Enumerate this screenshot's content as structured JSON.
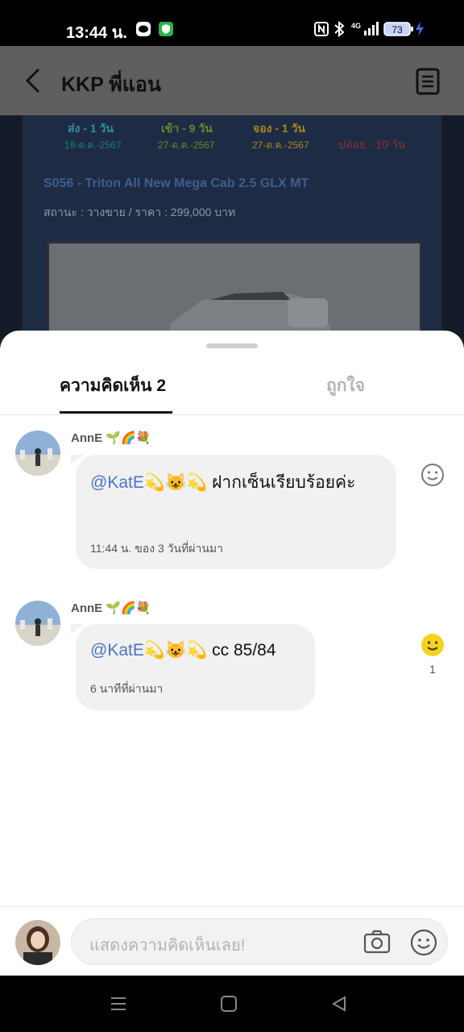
{
  "status_bar": {
    "time": "13:44 น.",
    "network": "4G",
    "battery": "73",
    "icons": [
      "line-icon",
      "shield-vpn-icon",
      "nfc-icon",
      "bluetooth-icon",
      "signal-icon",
      "battery-icon",
      "charging-icon"
    ]
  },
  "header": {
    "title": "KKP พี่แอน",
    "back_icon": "back-arrow-icon",
    "menu_icon": "document-list-icon"
  },
  "background_post": {
    "stats": [
      {
        "label": "ส่ง - 1 วัน",
        "date": "19-ต.ค.-2567",
        "color": "#2f8fa6"
      },
      {
        "label": "เข้า - 9 วัน",
        "date": "27-ต.ค.-2567",
        "color": "#5e8f2f"
      },
      {
        "label": "จอง - 1 วัน",
        "date": "27-ต.ค.-2567",
        "color": "#a9851e"
      },
      {
        "label": "",
        "date": "ปล่อย - 10 วัน",
        "color": "#8c3232"
      }
    ],
    "car_title": "S056 - Triton All New Mega Cab 2.5 GLX MT",
    "car_status": "สถานะ : วางขาย / ราคา : 299,000 บาท"
  },
  "tabs": {
    "comments": "ความคิดเห็น 2",
    "likes": "ถูกใจ"
  },
  "comments": [
    {
      "author": "AnnE 🌱🌈💐",
      "mention": "@KatE💫😺💫",
      "text": " ฝากเซ็นเรียบร้อยค่ะ",
      "time": "11:44 น. ของ 3 วันที่ผ่านมา",
      "reaction_count": ""
    },
    {
      "author": "AnnE 🌱🌈💐",
      "mention": "@KatE💫😺💫",
      "text": " cc 85/84",
      "time": "6 นาทีที่ผ่านมา",
      "reaction_count": "1"
    }
  ],
  "composer": {
    "placeholder": "แสดงความคิดเห็นเลย!",
    "camera_icon": "camera-icon",
    "emoji_icon": "emoji-icon"
  },
  "nav_bar": {
    "icons": [
      "recent-apps-icon",
      "home-icon",
      "back-icon"
    ]
  },
  "colors": {
    "mention": "#4a74c9",
    "reaction_active": "#f7d21b",
    "bubble": "#f1f1f1"
  }
}
